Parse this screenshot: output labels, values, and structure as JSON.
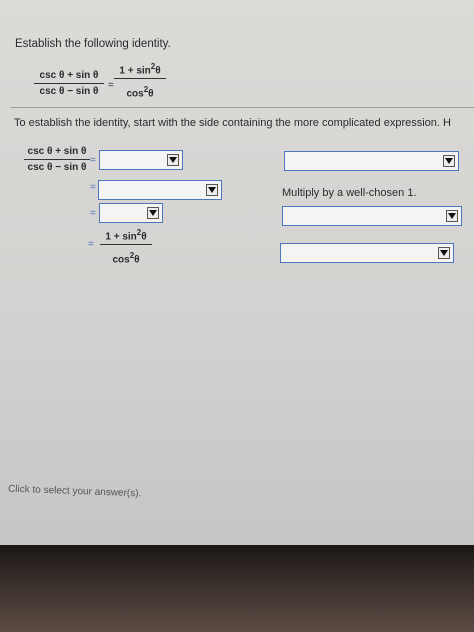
{
  "prompt": "Establish the following identity.",
  "identity": {
    "lhs_num": "csc θ + sin θ",
    "lhs_den": "csc θ − sin θ",
    "rhs_num": "1 + sin",
    "rhs_num_sup": "2",
    "rhs_num_var": "θ",
    "rhs_den": "cos",
    "rhs_den_sup": "2",
    "rhs_den_var": "θ",
    "equals": "="
  },
  "instruction": "To establish the identity, start with the side containing the more complicated expression. H",
  "steps": {
    "row1_num": "csc θ + sin θ",
    "row1_den": "csc θ − sin θ",
    "equals": "=",
    "final_num": "1 + sin",
    "final_num_sup": "2",
    "final_num_var": "θ",
    "final_den": "cos",
    "final_den_sup": "2",
    "final_den_var": "θ"
  },
  "hint": "Multiply by a well-chosen 1.",
  "footer": "Click to select your answer(s)."
}
